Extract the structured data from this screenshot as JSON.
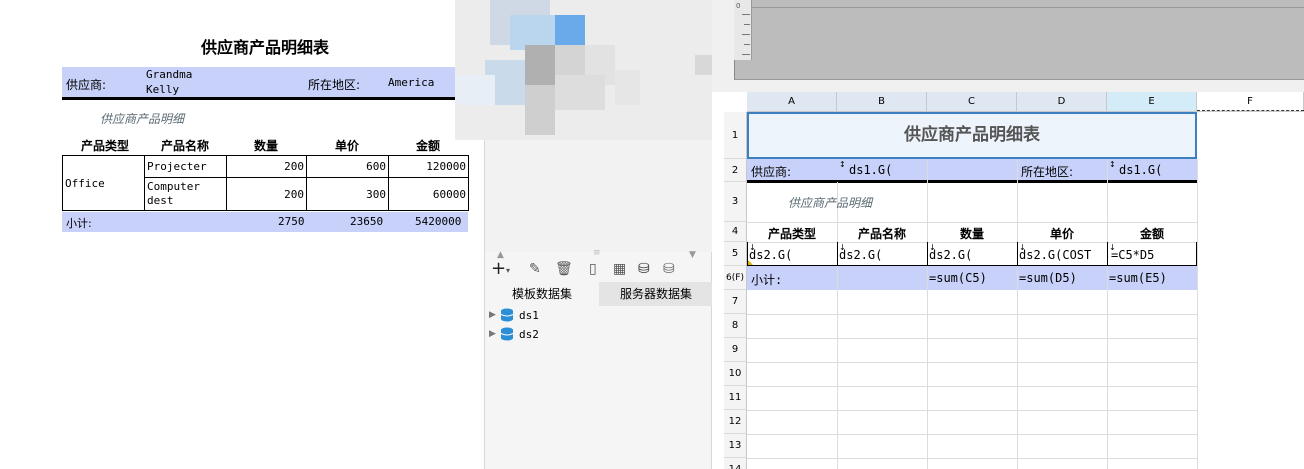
{
  "preview": {
    "title": "供应商产品明细表",
    "supplier_label": "供应商:",
    "supplier_value_line1": "Grandma",
    "supplier_value_line2": "Kelly",
    "region_label": "所在地区:",
    "region_value": "America",
    "subtitle": "供应商产品明细",
    "headers": [
      "产品类型",
      "产品名称",
      "数量",
      "单价",
      "金额"
    ],
    "group": "Office",
    "rows": [
      {
        "name": "Projecter",
        "qty": "200",
        "price": "600",
        "amount": "120000"
      },
      {
        "name_line1": "Computer",
        "name_line2": "dest",
        "qty": "200",
        "price": "300",
        "amount": "60000"
      }
    ],
    "total_label": "小计:",
    "total_qty": "2750",
    "total_price": "23650",
    "total_amount": "5420000"
  },
  "panel": {
    "tabs": [
      "模板数据集",
      "服务器数据集"
    ],
    "datasets": [
      "ds1",
      "ds2"
    ]
  },
  "designer": {
    "columns": [
      "A",
      "B",
      "C",
      "D",
      "E",
      "F"
    ],
    "rows": [
      "1",
      "2",
      "3",
      "4",
      "5",
      "6(F)",
      "7",
      "8",
      "9",
      "10",
      "11",
      "12",
      "13",
      "14"
    ],
    "title": "供应商产品明细表",
    "supplier_label": "供应商:",
    "supplier_formula": "ds1.G(",
    "region_label": "所在地区:",
    "region_formula": "ds1.G(",
    "subtitle": "供应商产品明细",
    "headers": [
      "产品类型",
      "产品名称",
      "数量",
      "单价",
      "金额"
    ],
    "row5": [
      "ds2.G(",
      "ds2.G(",
      "ds2.G(",
      "ds2.G(COST",
      "=C5*D5"
    ],
    "subtotal_label": "小计:",
    "row6": [
      "=sum(C5)",
      "=sum(D5)",
      "=sum(E5)"
    ]
  },
  "colors": {
    "header_band": "#c7d1f9",
    "selected_cell": "#eef4fc",
    "selected_border": "#3d7fc1"
  }
}
